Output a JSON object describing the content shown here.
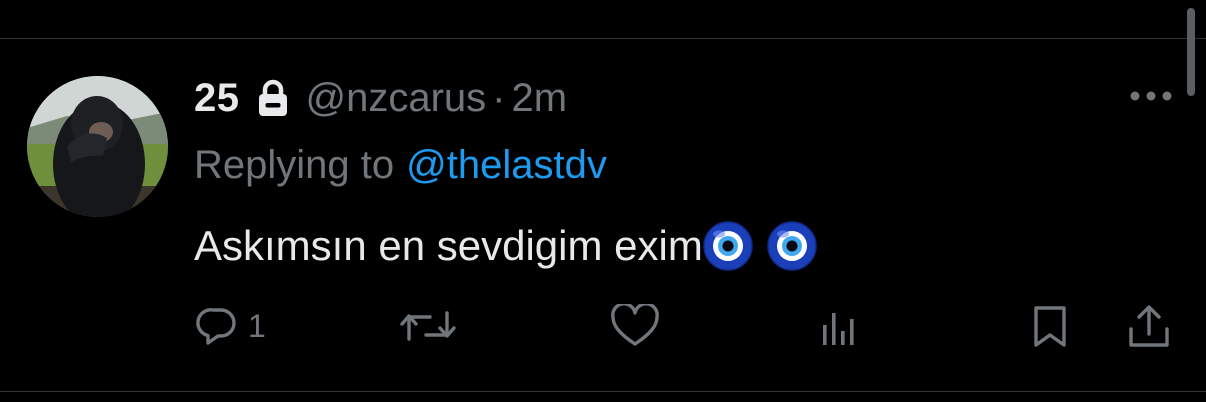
{
  "tweet": {
    "display_name": "25",
    "protected_icon": "lock-icon",
    "handle": "@nzcarus",
    "separator": "·",
    "time": "2m",
    "more_icon": "more-horizontal-icon",
    "reply_prefix": "Replying to",
    "reply_target": "@thelastdv",
    "text": "Askımsın en sevdigim exim",
    "emojis": [
      "nazar-amulet-icon",
      "nazar-amulet-icon"
    ]
  },
  "actions": {
    "reply": {
      "icon": "reply-icon",
      "count": "1"
    },
    "retweet": {
      "icon": "retweet-icon"
    },
    "like": {
      "icon": "heart-icon"
    },
    "views": {
      "icon": "views-bar-chart-icon"
    },
    "bookmark": {
      "icon": "bookmark-icon"
    },
    "share": {
      "icon": "share-icon"
    }
  },
  "colors": {
    "background": "#000000",
    "primary_text": "#e7e9ea",
    "secondary_text": "#71767b",
    "link": "#1d9bf0",
    "divider": "#2f3336"
  }
}
